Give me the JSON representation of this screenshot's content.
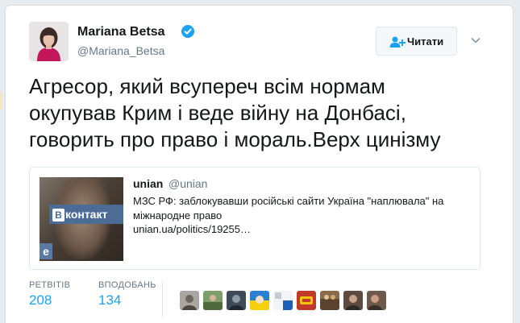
{
  "user": {
    "name": "Mariana Betsa",
    "handle": "@Mariana_Betsa"
  },
  "follow_button": {
    "label": "Читати",
    "icon": "add-person-icon"
  },
  "tweet": {
    "lines": [
      "Агресор, який всупереч всім нормам",
      "окупував Крим і веде війну на Донбасі,",
      "говорить про право і мораль.Верх цинізму"
    ]
  },
  "quoted": {
    "name": "unian",
    "handle": "@unian",
    "text": "МЗС РФ: заблокувавши російські сайти Україна \"наплювала\" на міжнародне право",
    "link": "unian.ua/politics/19255…",
    "image_badge": "контакт",
    "image_badge_prefix": "В",
    "image_edge_letter": "e"
  },
  "stats": {
    "retweets_label": "РЕТВІТІВ",
    "retweets": "208",
    "likes_label": "ВПОДОБАНЬ",
    "likes": "134"
  },
  "colors": {
    "accent": "#1da1f2",
    "verified": "#1da1f2",
    "text": "#14171a",
    "muted": "#657786"
  },
  "likers": [
    {
      "icon": "liker-avatar"
    },
    {
      "icon": "liker-avatar"
    },
    {
      "icon": "liker-avatar"
    },
    {
      "icon": "liker-avatar"
    },
    {
      "icon": "liker-avatar"
    },
    {
      "icon": "liker-avatar"
    },
    {
      "icon": "liker-avatar"
    },
    {
      "icon": "liker-avatar"
    },
    {
      "icon": "liker-avatar"
    }
  ]
}
